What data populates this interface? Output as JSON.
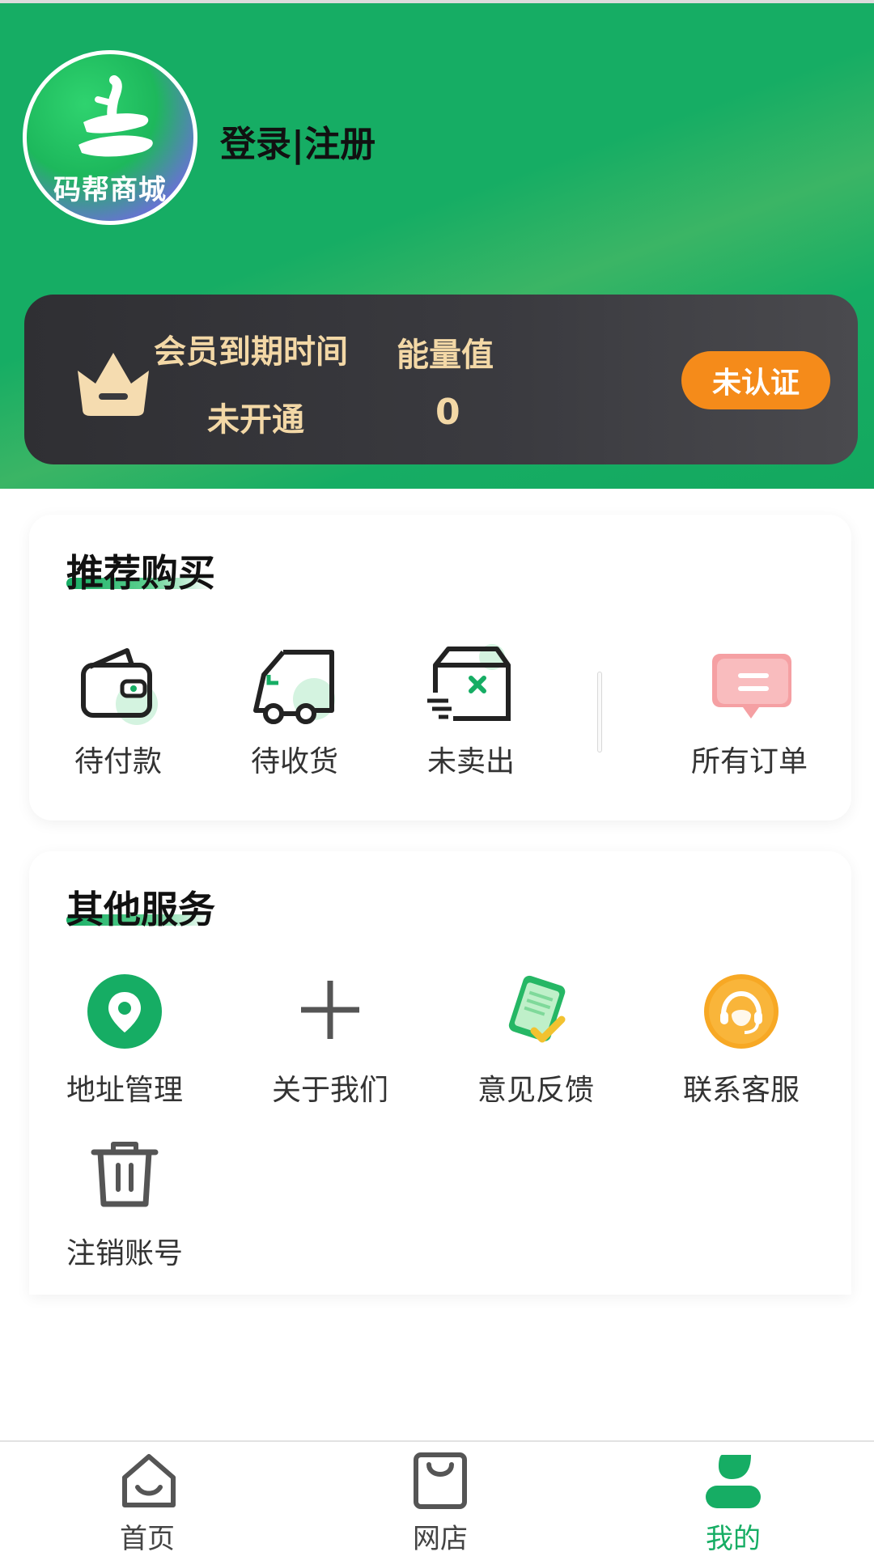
{
  "header": {
    "logo_text": "码帮商城",
    "login_label": "登录|注册"
  },
  "member": {
    "expiry_label": "会员到期时间",
    "expiry_value": "未开通",
    "energy_label": "能量值",
    "energy_value": "0",
    "cert_button": "未认证"
  },
  "orders": {
    "title": "推荐购买",
    "items": [
      {
        "label": "待付款",
        "icon": "wallet-icon"
      },
      {
        "label": "待收货",
        "icon": "truck-icon"
      },
      {
        "label": "未卖出",
        "icon": "box-x-icon"
      },
      {
        "label": "所有订单",
        "icon": "message-icon"
      }
    ]
  },
  "services": {
    "title": "其他服务",
    "items": [
      {
        "label": "地址管理",
        "icon": "location-pin-icon"
      },
      {
        "label": "关于我们",
        "icon": "plus-icon"
      },
      {
        "label": "意见反馈",
        "icon": "clipboard-check-icon"
      },
      {
        "label": "联系客服",
        "icon": "customer-service-icon"
      },
      {
        "label": "注销账号",
        "icon": "trash-icon"
      }
    ]
  },
  "bottom_nav": {
    "items": [
      {
        "label": "首页",
        "icon": "home-icon"
      },
      {
        "label": "网店",
        "icon": "shopping-bag-icon"
      },
      {
        "label": "我的",
        "icon": "user-icon"
      }
    ],
    "active_index": 2
  },
  "colors": {
    "brand_green": "#16ad64",
    "cert_orange": "#f58b1a",
    "gold_text": "#f3d8a6"
  }
}
